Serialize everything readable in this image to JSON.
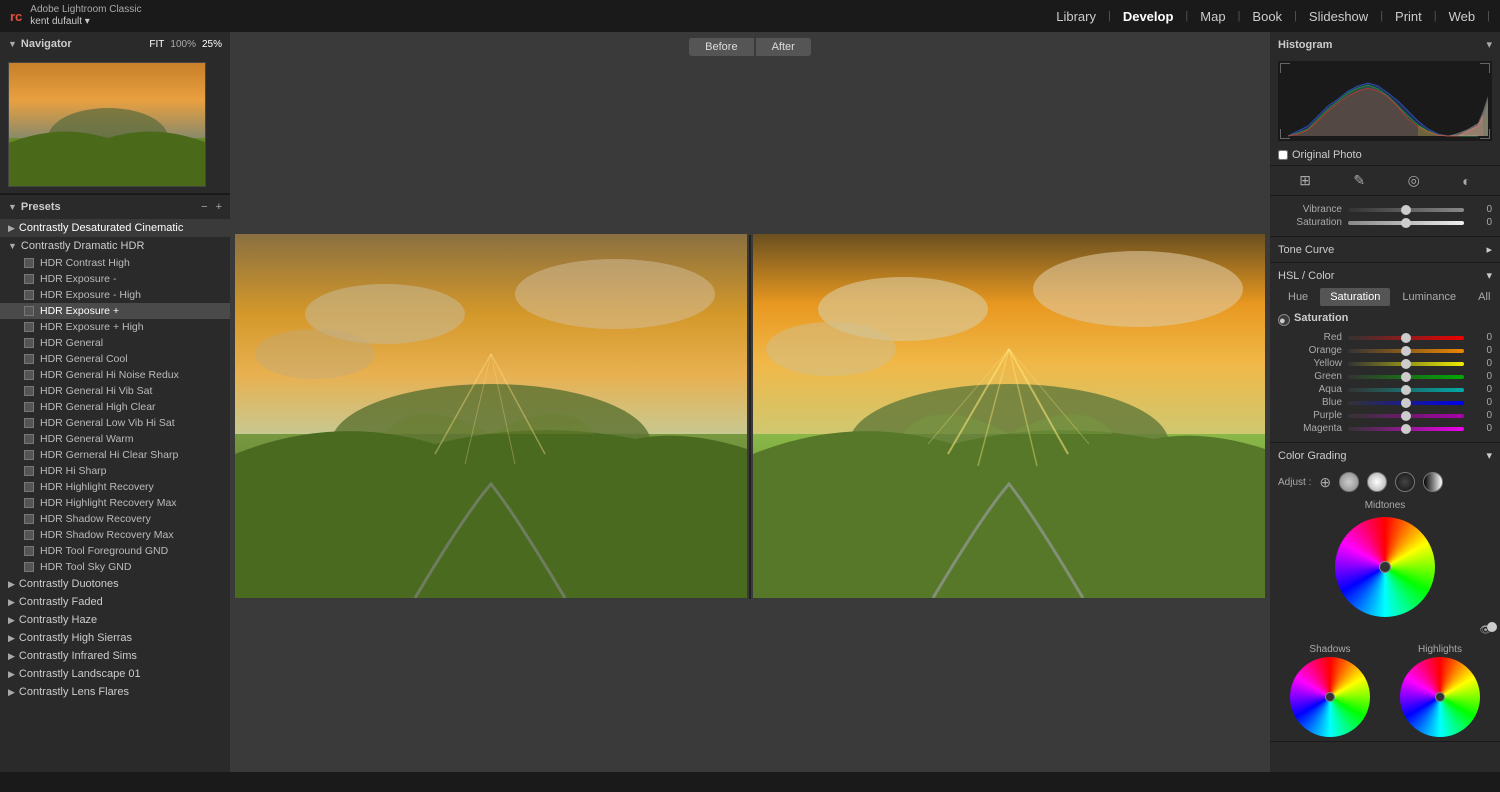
{
  "app": {
    "logo": "rc",
    "name": "Adobe Lightroom Classic",
    "user": "kent dufault ▾"
  },
  "nav": {
    "items": [
      "Library",
      "Develop",
      "Map",
      "Book",
      "Slideshow",
      "Print",
      "Web"
    ],
    "active": "Develop"
  },
  "navigator": {
    "title": "Navigator",
    "zoom_fit": "FIT",
    "zoom_100": "100%",
    "zoom_25": "25%"
  },
  "presets": {
    "title": "Presets",
    "add": "+",
    "remove": "−",
    "groups": [
      {
        "name": "Contrastly Desaturated Cinematic",
        "expanded": false,
        "active": true,
        "items": []
      },
      {
        "name": "Contrastly Dramatic HDR",
        "expanded": true,
        "items": [
          "HDR Contrast High",
          "HDR Exposure -",
          "HDR Exposure - High",
          "HDR Exposure +",
          "HDR Exposure + High",
          "HDR General",
          "HDR General Cool",
          "HDR General Hi Noise Redux",
          "HDR General Hi Vib Sat",
          "HDR General High Clear",
          "HDR General Low Vib Hi Sat",
          "HDR General Warm",
          "HDR Gerneral Hi Clear Sharp",
          "HDR Hi Sharp",
          "HDR Highlight Recovery",
          "HDR Highlight Recovery Max",
          "HDR Shadow Recovery",
          "HDR Shadow Recovery Max",
          "HDR Tool Foreground GND",
          "HDR Tool Sky GND"
        ]
      },
      {
        "name": "Contrastly Duotones",
        "expanded": false,
        "items": []
      },
      {
        "name": "Contrastly Faded",
        "expanded": false,
        "items": []
      },
      {
        "name": "Contrastly Haze",
        "expanded": false,
        "items": []
      },
      {
        "name": "Contrastly High Sierras",
        "expanded": false,
        "items": []
      },
      {
        "name": "Contrastly Infrared Sims",
        "expanded": false,
        "items": []
      },
      {
        "name": "Contrastly Landscape 01",
        "expanded": false,
        "items": []
      },
      {
        "name": "Contrastly Lens Flares",
        "expanded": false,
        "items": []
      }
    ]
  },
  "before_after": {
    "before_label": "Before",
    "after_label": "After"
  },
  "histogram": {
    "title": "Histogram",
    "original_photo_label": "Original Photo"
  },
  "adjustments": {
    "vibrance_label": "Vibrance",
    "vibrance_value": "0",
    "saturation_label": "Saturation",
    "saturation_value": "0"
  },
  "tone_curve": {
    "title": "Tone Curve",
    "arrow": "▸"
  },
  "hsl": {
    "title": "HSL / Color",
    "arrow": "▾",
    "tabs": [
      "Hue",
      "Saturation",
      "Luminance",
      "All"
    ],
    "active_tab": "Saturation",
    "section_label": "Saturation",
    "sliders": [
      {
        "label": "Red",
        "value": "0",
        "track": "red",
        "pos": 50
      },
      {
        "label": "Orange",
        "value": "0",
        "track": "orange",
        "pos": 50
      },
      {
        "label": "Yellow",
        "value": "0",
        "track": "yellow",
        "pos": 50
      },
      {
        "label": "Green",
        "value": "0",
        "track": "green",
        "pos": 50
      },
      {
        "label": "Aqua",
        "value": "0",
        "track": "aqua",
        "pos": 50
      },
      {
        "label": "Blue",
        "value": "0",
        "track": "blue",
        "pos": 50
      },
      {
        "label": "Purple",
        "value": "0",
        "track": "purple",
        "pos": 50
      },
      {
        "label": "Magenta",
        "value": "0",
        "track": "magenta",
        "pos": 50
      }
    ]
  },
  "color_grading": {
    "title": "Color Grading",
    "arrow": "▾",
    "adjust_label": "Adjust :",
    "midtones_label": "Midtones",
    "shadows_label": "Shadows",
    "highlights_label": "Highlights"
  }
}
